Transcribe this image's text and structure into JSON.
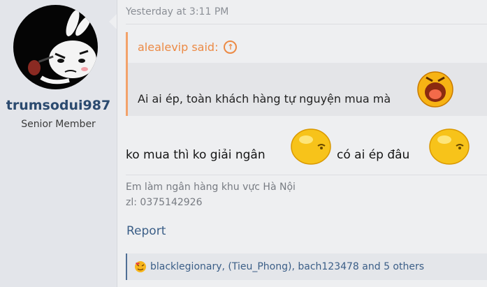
{
  "user": {
    "name": "trumsodui987",
    "title": "Senior Member"
  },
  "post": {
    "date": "Yesterday at 3:11 PM",
    "quote": {
      "author": "alealevip said:",
      "text": "Ai ai ép, toàn khách hàng tự nguyện mua mà"
    },
    "message": {
      "part1": "ko mua thì ko giải ngân",
      "part2": "có ai ép đâu"
    },
    "signature": {
      "line1": "Em làm ngân hàng khu vực Hà Nội",
      "line2": "zl: 0375142926"
    },
    "report_label": "Report",
    "reactions": "blacklegionary, (Tieu_Phong), bach123478 and 5 others"
  },
  "colors": {
    "accent_quote": "#ec8a45",
    "link": "#3b5e87",
    "username": "#2b4a6f"
  }
}
